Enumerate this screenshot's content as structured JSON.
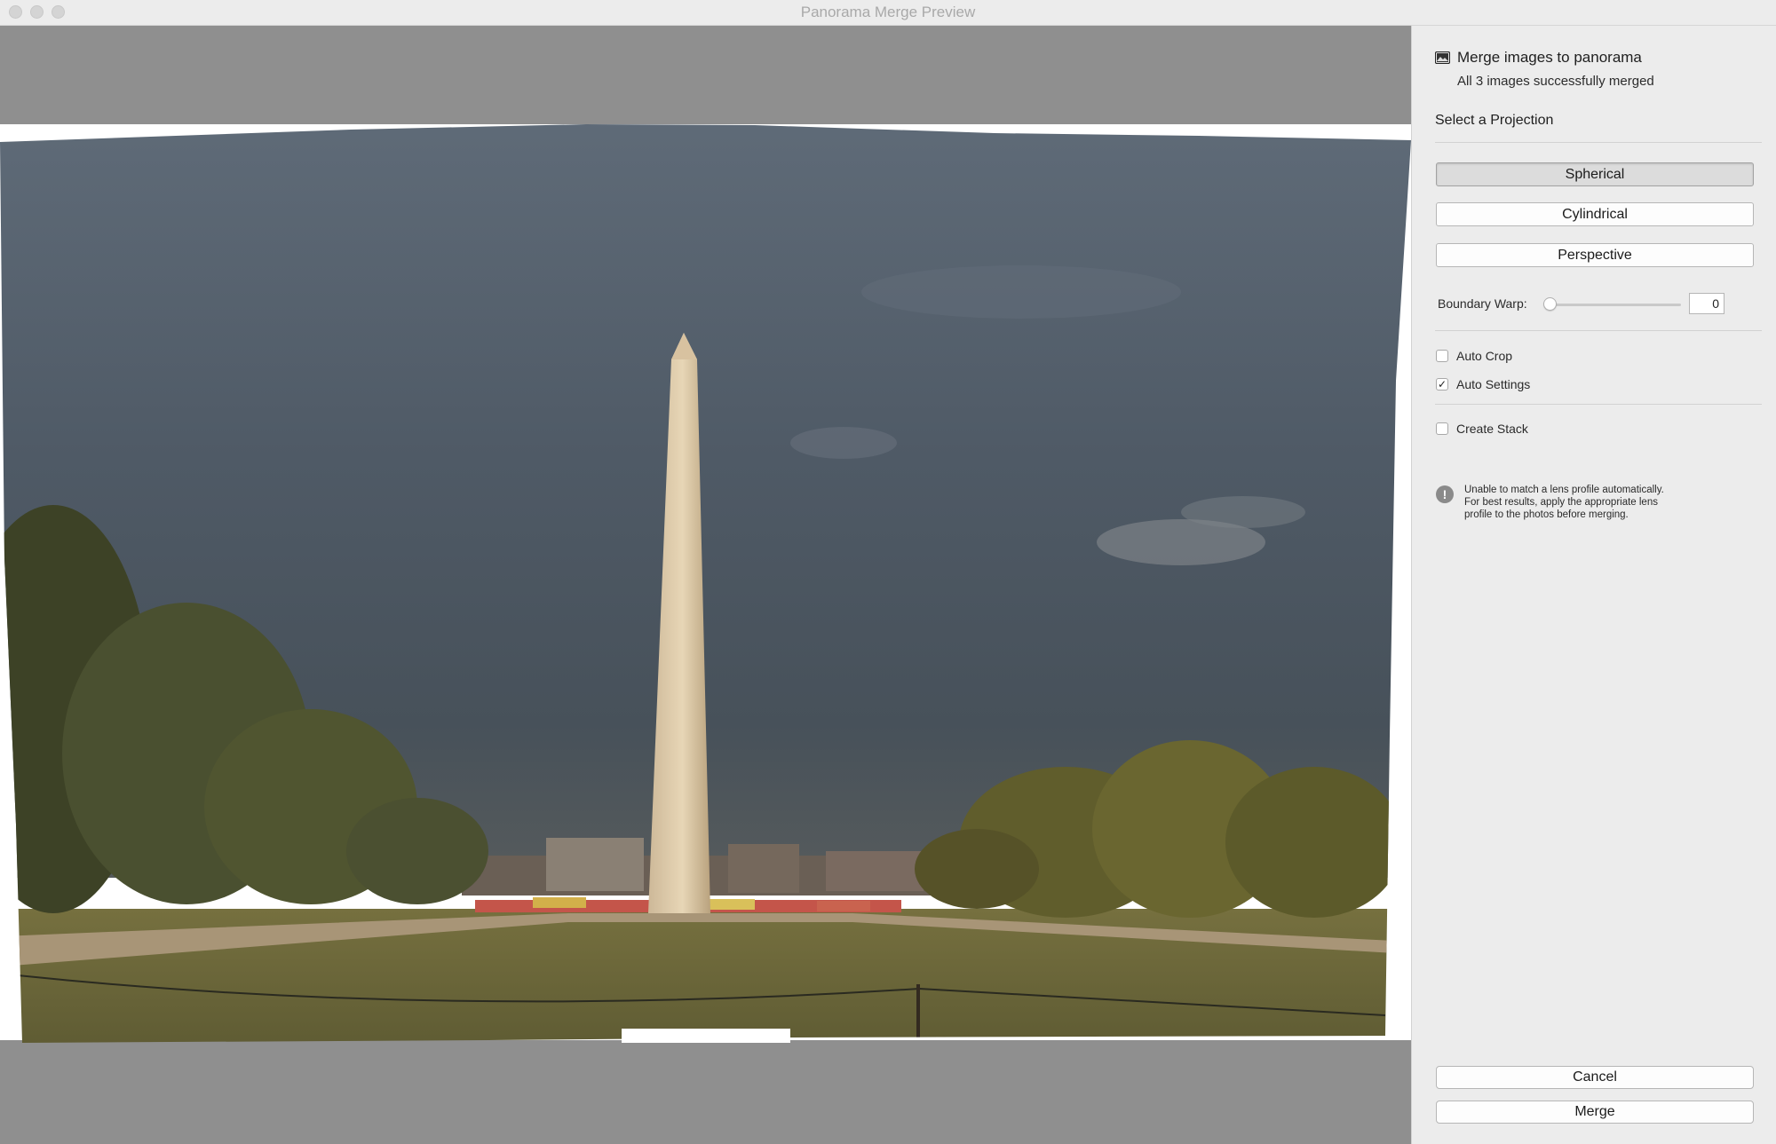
{
  "window": {
    "title": "Panorama Merge Preview"
  },
  "panel": {
    "title": "Merge images to panorama",
    "subtitle": "All 3 images successfully merged",
    "projection_label": "Select a Projection",
    "projections": [
      "Spherical",
      "Cylindrical",
      "Perspective"
    ],
    "selected_projection": "Spherical",
    "boundary_warp": {
      "label": "Boundary Warp:",
      "value": "0",
      "fraction": 0
    },
    "options": [
      {
        "label": "Auto Crop",
        "checked": false
      },
      {
        "label": "Auto Settings",
        "checked": true
      },
      {
        "label": "Create Stack",
        "checked": false
      }
    ],
    "warning": [
      "Unable to match a lens profile automatically.",
      "For best results, apply the appropriate lens",
      "profile to the photos before merging."
    ],
    "cancel_label": "Cancel",
    "merge_label": "Merge"
  },
  "colors": {
    "accent": "#9a9a9a",
    "panel_bg": "#ececec",
    "preview_bg": "#8f8f8f"
  }
}
